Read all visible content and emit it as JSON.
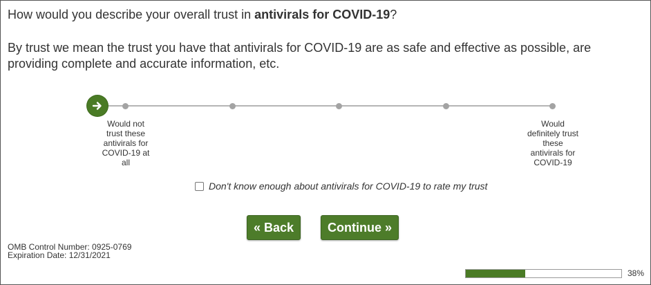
{
  "question": {
    "prefix": "How would you describe your overall trust in ",
    "bold": "antivirals for COVID-19",
    "suffix": "?"
  },
  "explanation": "By trust we mean the trust you have that antivirals for COVID-19 are as safe and effective as possible, are providing complete and accurate information, etc.",
  "scale": {
    "points": 5,
    "selected_index": 0,
    "knob_icon": "arrow-right-icon",
    "left_anchor": "Would not trust these antivirals for COVID-19 at all",
    "right_anchor": "Would definitely trust these antivirals for COVID-19"
  },
  "dont_know": {
    "label": "Don't know enough about antivirals for COVID-19 to rate my trust",
    "checked": false
  },
  "buttons": {
    "back": "« Back",
    "continue": "Continue »"
  },
  "footer": {
    "omb_line": "OMB Control Number: 0925-0769",
    "expiration_line": "Expiration Date: 12/31/2021"
  },
  "progress": {
    "percent": 38,
    "label": "38%"
  },
  "colors": {
    "accent_green": "#4a7b25",
    "track_gray": "#b5b5b5",
    "text": "#333333"
  }
}
